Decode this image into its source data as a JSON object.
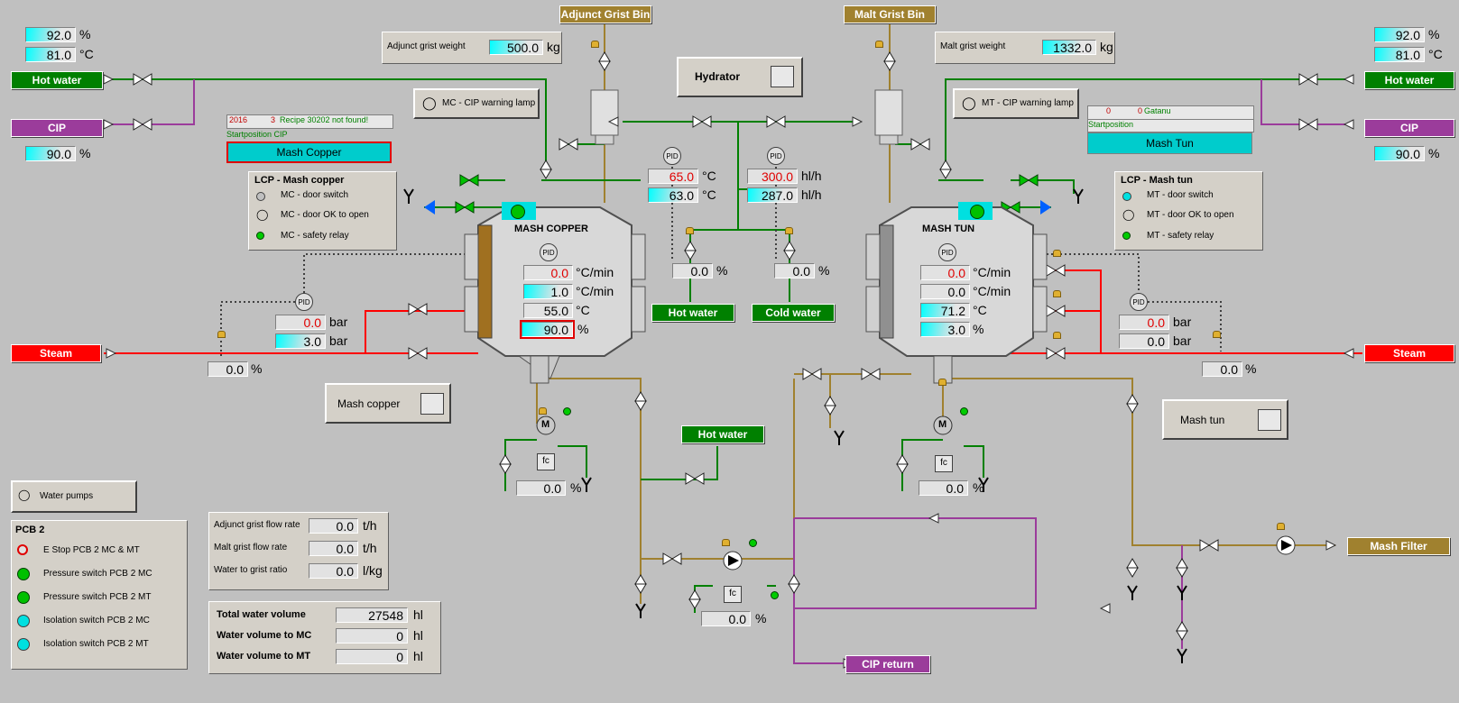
{
  "bins": {
    "adjunct": "Adjunct Grist Bin",
    "malt": "Malt Grist Bin"
  },
  "adjunct_weight": {
    "label": "Adjunct grist weight",
    "value": "500.0",
    "unit": "kg"
  },
  "malt_weight": {
    "label": "Malt grist weight",
    "value": "1332.0",
    "unit": "kg"
  },
  "left_top": {
    "pct": "92.0",
    "pct_unit": "%",
    "temp": "81.0",
    "temp_unit": "°C"
  },
  "right_top": {
    "pct": "92.0",
    "pct_unit": "%",
    "temp": "81.0",
    "temp_unit": "°C"
  },
  "left_hot_water": "Hot water",
  "left_cip": "CIP",
  "left_cip_val": {
    "value": "90.0",
    "unit": "%"
  },
  "right_hot_water": "Hot water",
  "right_cip": "CIP",
  "right_cip_val": {
    "value": "90.0",
    "unit": "%"
  },
  "hydrator": "Hydrator",
  "mc_cip_lamp": "MC - CIP warning lamp",
  "mt_cip_lamp": "MT - CIP warning lamp",
  "mc_recipe": {
    "year": "2016",
    "num": "3",
    "msg": "Recipe 30202 not found!",
    "start": "Startposition CIP",
    "button": "Mash Copper"
  },
  "mt_recipe": {
    "a": "0",
    "b": "0",
    "name": "Gatanu",
    "start": "Startposition",
    "button": "Mash Tun"
  },
  "lcp_mc": {
    "title": "LCP - Mash copper",
    "items": [
      "MC - door switch",
      "MC - door OK to open",
      "MC - safety relay"
    ]
  },
  "lcp_mt": {
    "title": "LCP - Mash tun",
    "items": [
      "MT - door switch",
      "MT - door OK to open",
      "MT - safety relay"
    ]
  },
  "center_pid": {
    "temp_sp": "65.0",
    "temp_pv": "63.0",
    "temp_unit": "°C",
    "flow_sp": "300.0",
    "flow_pv": "287.0",
    "flow_unit": "hl/h",
    "pid": "PID"
  },
  "hot_valve": {
    "value": "0.0",
    "unit": "%"
  },
  "cold_valve": {
    "value": "0.0",
    "unit": "%"
  },
  "center_hot_water": "Hot water",
  "center_cold_water": "Cold water",
  "mash_copper": {
    "name": "MASH COPPER",
    "rate_sp": "0.0",
    "rate_pv": "1.0",
    "rate_unit": "°C/min",
    "temp": "55.0",
    "temp_unit": "°C",
    "level": "90.0",
    "level_unit": "%"
  },
  "mash_tun": {
    "name": "MASH TUN",
    "rate_sp": "0.0",
    "rate_pv": "0.0",
    "rate_unit": "°C/min",
    "temp": "71.2",
    "temp_unit": "°C",
    "level": "3.0",
    "level_unit": "%"
  },
  "mc_steam": {
    "sp": "0.0",
    "pv": "3.0",
    "unit": "bar",
    "valve": "0.0",
    "valve_unit": "%",
    "label": "Steam"
  },
  "mt_steam": {
    "sp": "0.0",
    "pv": "0.0",
    "unit": "bar",
    "valve": "0.0",
    "valve_unit": "%",
    "label": "Steam"
  },
  "mash_copper_btn": "Mash copper",
  "mash_tun_btn": "Mash tun",
  "mc_motor": {
    "label": "M",
    "fc": "fc",
    "value": "0.0",
    "unit": "%"
  },
  "mt_motor": {
    "label": "M",
    "fc": "fc",
    "value": "0.0",
    "unit": "%"
  },
  "pump_fc": {
    "fc": "fc",
    "value": "0.0",
    "unit": "%"
  },
  "mid_hot_water": "Hot water",
  "water_pumps": "Water pumps",
  "pcb": {
    "title": "PCB 2",
    "items": [
      {
        "icon": "estop-icon",
        "label": "E Stop PCB 2 MC & MT"
      },
      {
        "icon": "ps-icon",
        "label": "Pressure switch PCB 2 MC"
      },
      {
        "icon": "ps-icon",
        "label": "Pressure switch PCB 2 MT"
      },
      {
        "icon": "is-icon",
        "label": "Isolation switch PCB 2 MC"
      },
      {
        "icon": "is-icon",
        "label": "Isolation switch PCB 2 MT"
      }
    ]
  },
  "flow": {
    "adjunct": {
      "label": "Adjunct grist flow rate",
      "value": "0.0",
      "unit": "t/h"
    },
    "malt": {
      "label": "Malt grist flow rate",
      "value": "0.0",
      "unit": "t/h"
    },
    "ratio": {
      "label": "Water to grist ratio",
      "value": "0.0",
      "unit": "l/kg"
    }
  },
  "water_vol": {
    "total": {
      "label": "Total water volume",
      "value": "27548",
      "unit": "hl"
    },
    "mc": {
      "label": "Water volume to MC",
      "value": "0",
      "unit": "hl"
    },
    "mt": {
      "label": "Water volume to MT",
      "value": "0",
      "unit": "hl"
    }
  },
  "cip_return": "CIP return",
  "mash_filter": "Mash Filter",
  "pid_label": "PID",
  "colors": {
    "water": "#008000",
    "steam": "#ff0000",
    "cip": "#9b3c9b",
    "mash": "#a0812f",
    "accent": "#00cccc"
  }
}
